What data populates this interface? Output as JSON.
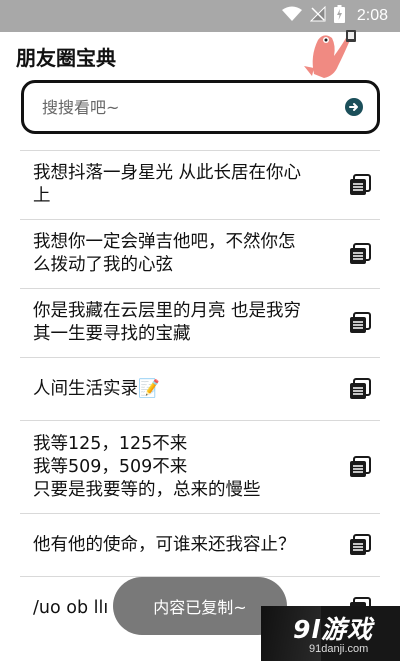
{
  "status_bar": {
    "time": "2:08",
    "icons": [
      "wifi-icon",
      "signal-off-icon",
      "battery-charging-icon"
    ]
  },
  "app": {
    "title": "朋友圈宝典"
  },
  "search": {
    "placeholder": "搜搜看吧~"
  },
  "entries": [
    {
      "text": "我想抖落一身星光 从此长居在你心\n上"
    },
    {
      "text": "我想你一定会弹吉他吧，不然你怎\n么拨动了我的心弦"
    },
    {
      "text": "你是我藏在云层里的月亮 也是我穷\n其一生要寻找的宝藏"
    },
    {
      "text": "人间生活实录📝"
    },
    {
      "text": "我等125，125不来\n我等509，509不来\n只要是我要等的，总来的慢些"
    },
    {
      "text": "他有他的使命，可谁来还我容止？"
    },
    {
      "text": "/uo ob llı"
    }
  ],
  "toast": {
    "text": "内容已复制~"
  },
  "watermark": {
    "logo": "9l游戏",
    "url": "91danji.com"
  },
  "colors": {
    "status_bar": "#a8a8a8",
    "search_go": "#1b4f5a",
    "divider": "#d9d9d9",
    "toast_bg": "#6e6e6e"
  }
}
